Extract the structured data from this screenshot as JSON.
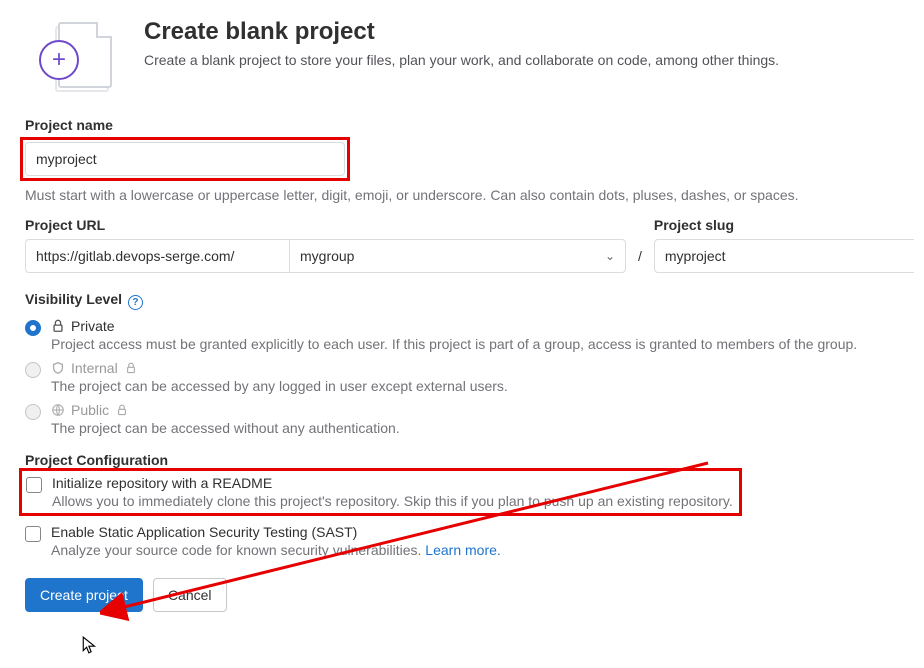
{
  "header": {
    "title": "Create blank project",
    "subtitle": "Create a blank project to store your files, plan your work, and collaborate on code, among other things."
  },
  "projectName": {
    "label": "Project name",
    "value": "myproject",
    "hint": "Must start with a lowercase or uppercase letter, digit, emoji, or underscore. Can also contain dots, pluses, dashes, or spaces."
  },
  "projectUrl": {
    "label": "Project URL",
    "base": "https://gitlab.devops-serge.com/",
    "namespace": "mygroup",
    "separator": "/"
  },
  "projectSlug": {
    "label": "Project slug",
    "value": "myproject"
  },
  "visibility": {
    "label": "Visibility Level",
    "helpChar": "?",
    "options": [
      {
        "name": "Private",
        "desc": "Project access must be granted explicitly to each user. If this project is part of a group, access is granted to members of the group."
      },
      {
        "name": "Internal",
        "desc": "The project can be accessed by any logged in user except external users."
      },
      {
        "name": "Public",
        "desc": "The project can be accessed without any authentication."
      }
    ]
  },
  "config": {
    "label": "Project Configuration",
    "readme": {
      "label": "Initialize repository with a README",
      "desc": "Allows you to immediately clone this project's repository. Skip this if you plan to push up an existing repository."
    },
    "sast": {
      "label": "Enable Static Application Security Testing (SAST)",
      "descPrefix": "Analyze your source code for known security vulnerabilities. ",
      "learnMore": "Learn more."
    }
  },
  "buttons": {
    "create": "Create project",
    "cancel": "Cancel"
  }
}
